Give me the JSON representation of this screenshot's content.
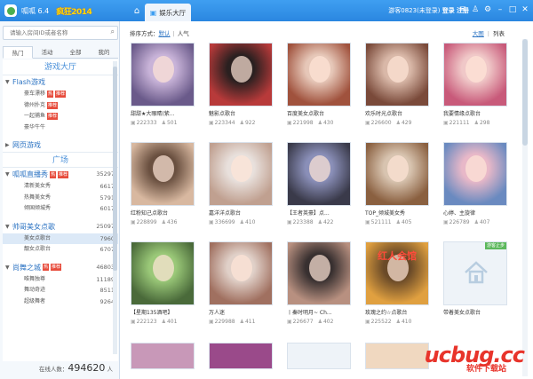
{
  "titlebar": {
    "app_name": "呱呱 6.4",
    "banner": "疯狂2014",
    "active_tab": "娱乐大厅",
    "user": "游客0823(未登录)",
    "login": "登录",
    "register": "注册"
  },
  "sidebar": {
    "search_placeholder": "请输入房间ID或者名称",
    "tabs": [
      "热门",
      "活动",
      "全部",
      "我的"
    ],
    "sections": {
      "game_hall": "游戏大厅",
      "flash": "Flash游戏",
      "web_games": "网页游戏",
      "plaza": "广场"
    },
    "flash_items": [
      {
        "label": "豪车漂移",
        "hot": "热",
        "rec": "推荐"
      },
      {
        "label": "德州扑克",
        "hot": "",
        "rec": "推荐"
      },
      {
        "label": "一起捕鱼",
        "hot": "",
        "rec": "推荐"
      },
      {
        "label": "豪华牛牛",
        "hot": "",
        "rec": ""
      }
    ],
    "groups": [
      {
        "label": "呱呱直播秀",
        "hot": "热",
        "rec": "推荐",
        "count": "35297",
        "items": [
          {
            "label": "清新美女秀",
            "count": "6617"
          },
          {
            "label": "热舞美女秀",
            "count": "5791"
          },
          {
            "label": "倾国倾城秀",
            "count": "6017"
          }
        ]
      },
      {
        "label": "帅哥美女点歌",
        "hot": "",
        "rec": "",
        "count": "25097",
        "items": [
          {
            "label": "美女点歌台",
            "count": "7960"
          },
          {
            "label": "靓女点歌台",
            "count": "6707"
          }
        ]
      },
      {
        "label": "尚舞之城",
        "hot": "热",
        "rec": "推荐",
        "count": "46803",
        "items": [
          {
            "label": "唯舞独尊",
            "count": "11189"
          },
          {
            "label": "舞动奇迹",
            "count": "8511"
          },
          {
            "label": "超级舞者",
            "count": "9264"
          }
        ]
      }
    ],
    "online_label": "在线人数：",
    "online_count": "494620",
    "online_unit": "人"
  },
  "main": {
    "sort_label": "排序方式：",
    "sort_default": "默认",
    "sort_popular": "人气",
    "view_large": "大图",
    "view_list": "列表",
    "rooms": [
      {
        "title": "甜甜★大眼睛(紫...",
        "id": "222333",
        "viewers": "501"
      },
      {
        "title": "魅影点歌台",
        "id": "223344",
        "viewers": "922"
      },
      {
        "title": "百度美女点歌台",
        "id": "221998",
        "viewers": "430"
      },
      {
        "title": "欢乐时光点歌台",
        "id": "226600",
        "viewers": "429"
      },
      {
        "title": "我要情缘点歌台",
        "id": "221111",
        "viewers": "298"
      },
      {
        "title": "红粉知己点歌台",
        "id": "228899",
        "viewers": "436"
      },
      {
        "title": "嘉洋洋点歌台",
        "id": "336699",
        "viewers": "410"
      },
      {
        "title": "【王者英豪】点...",
        "id": "223388",
        "viewers": "422"
      },
      {
        "title": "TOP_倾城美女秀",
        "id": "521111",
        "viewers": "405"
      },
      {
        "title": "心婷、主旋律",
        "id": "226789",
        "viewers": "407"
      },
      {
        "title": "【星期135酒吧】",
        "id": "222123",
        "viewers": "401"
      },
      {
        "title": "万人迷",
        "id": "229988",
        "viewers": "411"
      },
      {
        "title": "丨秦时明月~ Ch...",
        "id": "226677",
        "viewers": "402"
      },
      {
        "title": "玫瑰之约☆点歌台",
        "id": "225522",
        "viewers": "410"
      },
      {
        "title": "带着美女点歌台",
        "id": "",
        "viewers": "",
        "badge": "游客止步"
      }
    ],
    "partial_card_text": "红人会馆"
  },
  "watermark": {
    "logo": "ucbug.cc",
    "sub": "软件下载站"
  }
}
